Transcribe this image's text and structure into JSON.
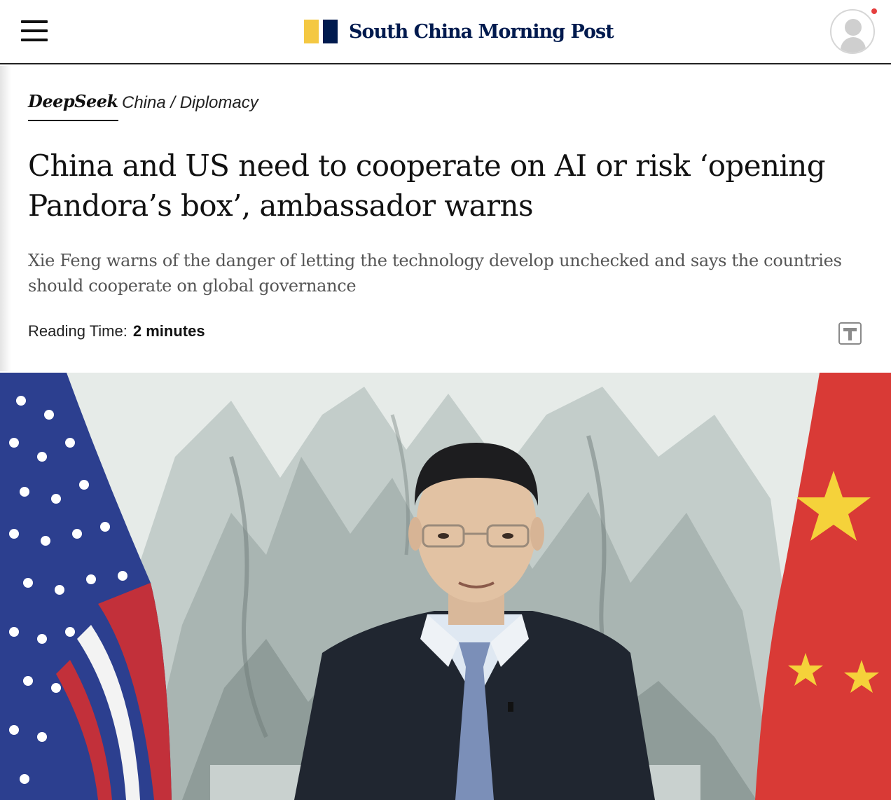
{
  "header": {
    "logo_text": "South China Morning Post",
    "logo_colors": {
      "left_block": "#f4c842",
      "right_block": "#001a4e"
    }
  },
  "article": {
    "section_primary": "DeepSeek",
    "section_secondary": "China / Diplomacy",
    "headline": "China and US need to cooperate on AI or risk ‘opening Pandora’s box’, ambassador warns",
    "subheadline": "Xie Feng warns of the danger of letting the technology develop unchecked and says the countries should cooperate on global governance",
    "reading_time_label": "Reading Time:",
    "reading_time_value": "2 minutes"
  },
  "icons": {
    "menu": "hamburger-menu-icon",
    "profile": "user-avatar-icon",
    "text_size": "text-size-icon"
  },
  "colors": {
    "brand_navy": "#001a4e",
    "brand_yellow": "#f4c842",
    "notification": "#e53e3e"
  }
}
